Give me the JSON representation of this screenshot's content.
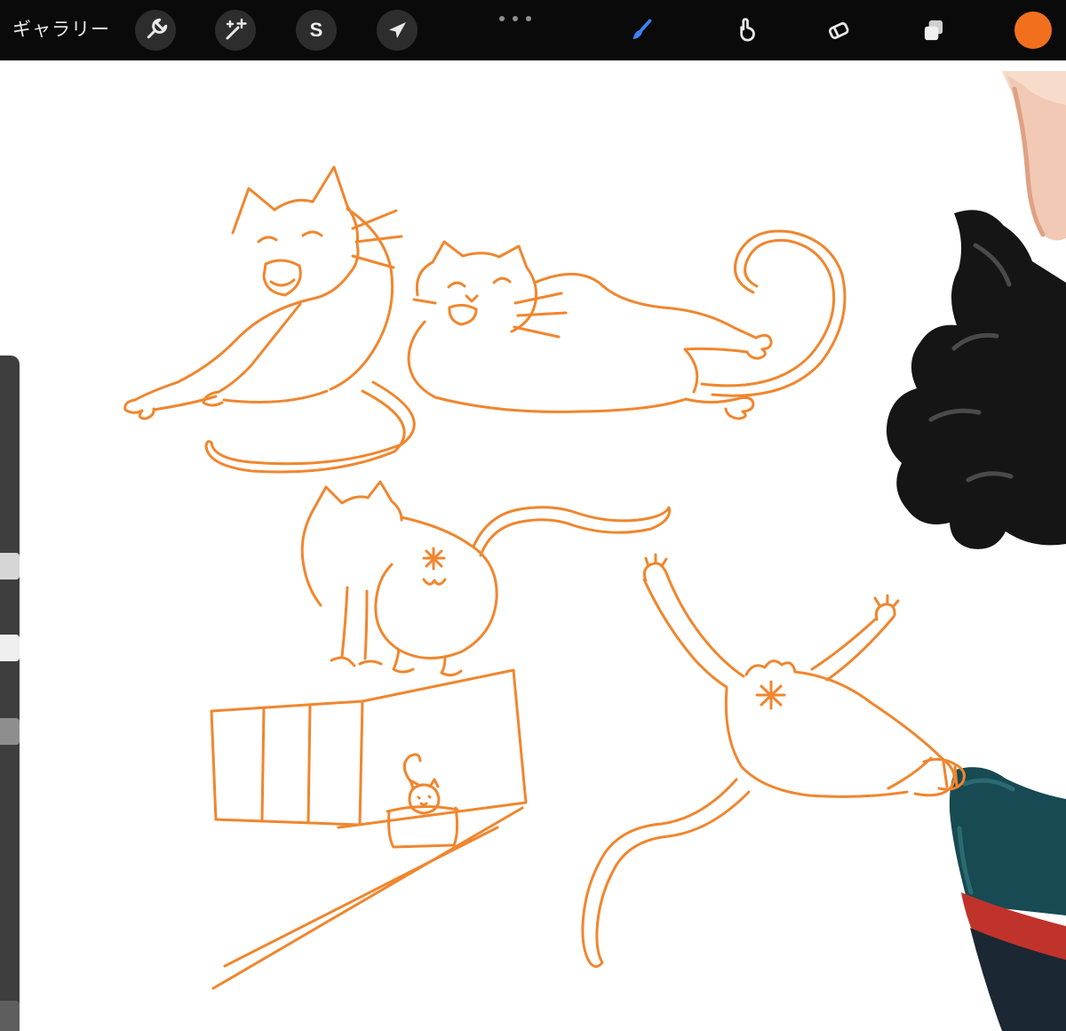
{
  "toolbar": {
    "background": "#0A0A0A",
    "circle_color": "#2D2D2D",
    "icon_color": "#E8E8E8",
    "gallery_label": "ギャラリー",
    "tools_left": [
      {
        "id": "actions",
        "icon": "wrench-icon"
      },
      {
        "id": "adjustments",
        "icon": "magic-wand-icon"
      },
      {
        "id": "selection",
        "icon": "s-glyph-icon",
        "glyph": "S"
      },
      {
        "id": "transform",
        "icon": "arrow-icon"
      }
    ],
    "overflow": {
      "icon": "ellipsis-icon"
    },
    "tools_right": [
      {
        "id": "paint",
        "icon": "brush-icon",
        "active": true,
        "color": "#3C82F7"
      },
      {
        "id": "smudge",
        "icon": "smudge-icon",
        "active": false
      },
      {
        "id": "erase",
        "icon": "eraser-icon",
        "active": false
      },
      {
        "id": "layers",
        "icon": "layers-icon",
        "active": false
      },
      {
        "id": "color",
        "icon": "color-swatch",
        "color": "#F2701D"
      }
    ]
  },
  "sidebar": {
    "background": "#3E3E3E",
    "items": [
      {
        "name": "brush-size-slider",
        "handle_color": "#D6D6D6"
      },
      {
        "name": "modify-button",
        "handle_color": "#EFEFEF"
      },
      {
        "name": "opacity-slider",
        "handle_color": "#8E8E8E"
      },
      {
        "name": "undo-redo-button",
        "handle_color": "#5E5E5E"
      }
    ]
  },
  "canvas": {
    "background": "#FFFFFF",
    "sketch_color": "#F0862E",
    "sketch_stroke_width": 3,
    "sketch_subjects": [
      "yawning cat lying down",
      "chubby smiling cat lying on its back with curled tail",
      "cat standing seen from behind with raised wavy tail",
      "small cat peeking out of a box with perspective lines",
      "cat rolling on its back with legs stretched out"
    ],
    "artwork": {
      "skin_light": "#F7DCCB",
      "skin": "#F2C9B4",
      "skin_shade": "#DFA183",
      "bow": "#151515",
      "bow_highlight": "#4A4A4A",
      "shoe": "#174A52",
      "shoe_highlight": "#2C6A72",
      "sole": "#C0332B",
      "heel": "#1B2732"
    }
  }
}
